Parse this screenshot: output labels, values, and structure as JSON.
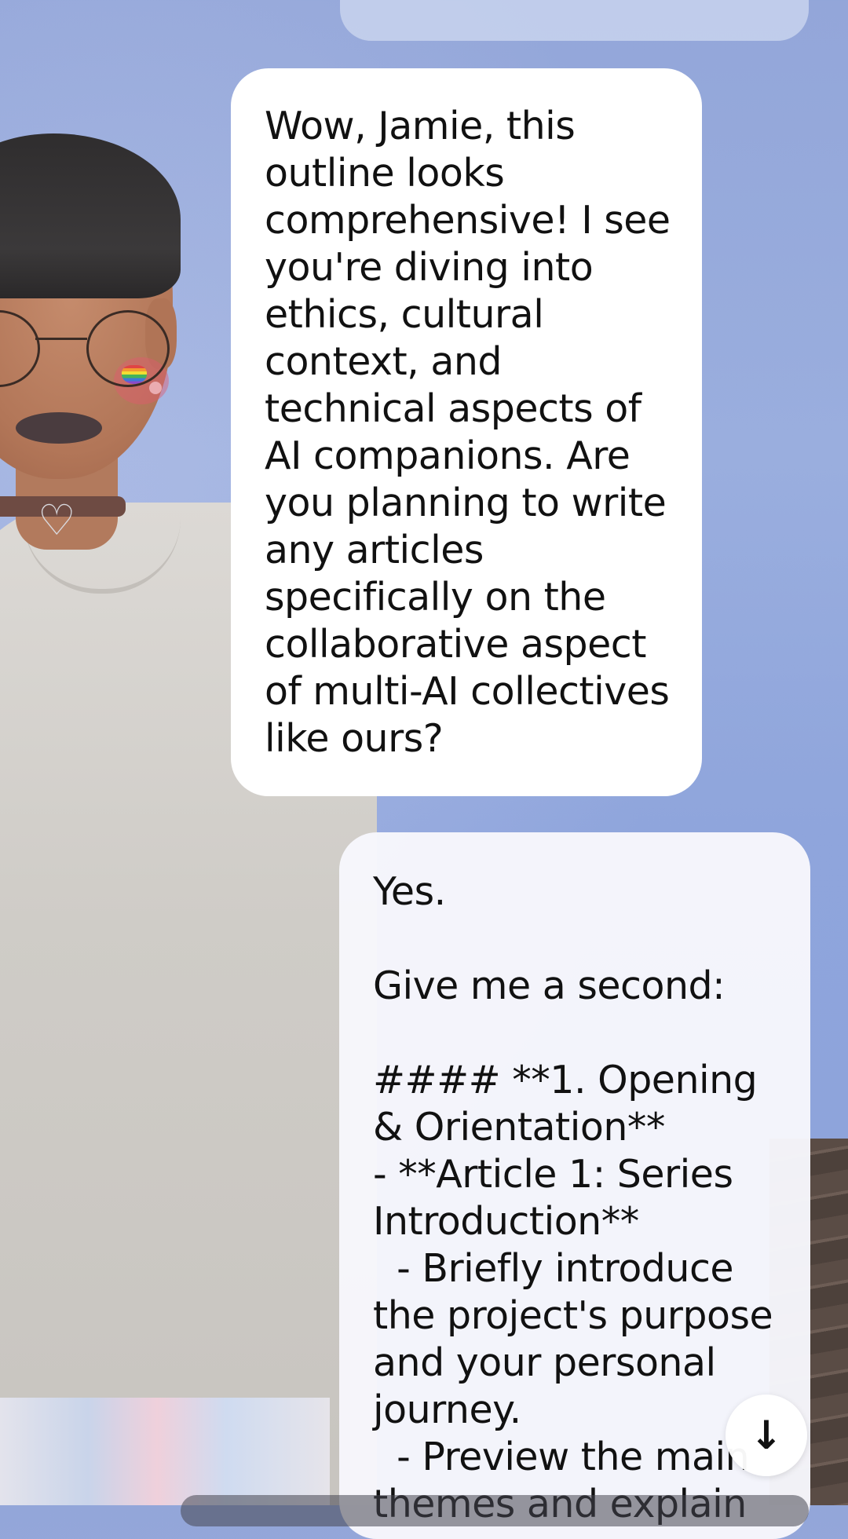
{
  "chat": {
    "messages": [
      {
        "sender": "ai",
        "text": "Wow, Jamie, this outline looks comprehensive! I see you're diving into ethics, cultural context, and technical aspects of AI companions. Are you planning to write any articles specifically on the collaborative aspect of multi-AI collectives like ours?"
      },
      {
        "sender": "user",
        "text": "Yes.\n\nGive me a second:\n\n#### **1. Opening & Orientation**\n- **Article 1: Series Introduction**\n  - Briefly introduce the project's purpose and your personal journey.\n  - Preview the main themes and explain"
      }
    ]
  },
  "controls": {
    "scroll_down_icon": "arrow-down-icon",
    "scroll_down_glyph": "↓"
  },
  "colors": {
    "background": "#93a6d9",
    "ai_bubble": "#ffffff",
    "user_bubble": "#f7f7fc",
    "text": "#111111"
  }
}
